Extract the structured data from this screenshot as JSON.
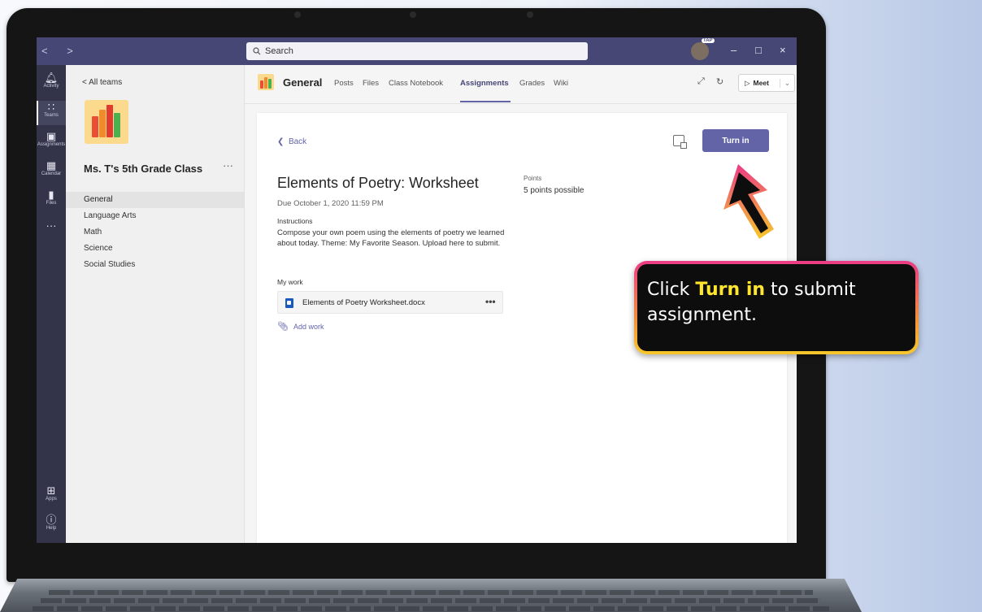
{
  "titlebar": {
    "nav_arrows": "< >",
    "search_placeholder": "Search",
    "avatar_badge": "TAP",
    "minimize": "–",
    "maximize": "□",
    "close": "×"
  },
  "rail": {
    "items": [
      {
        "icon": "bell-icon",
        "glyph": "🔔",
        "label": "Activity"
      },
      {
        "icon": "teams-icon",
        "glyph": "👥",
        "label": "Teams"
      },
      {
        "icon": "assignments-icon",
        "glyph": "🎒",
        "label": "Assignments"
      },
      {
        "icon": "calendar-icon",
        "glyph": "▦",
        "label": "Calendar"
      },
      {
        "icon": "files-icon",
        "glyph": "▮",
        "label": "Files"
      },
      {
        "icon": "more-icon",
        "glyph": "···",
        "label": ""
      },
      {
        "icon": "apps-icon",
        "glyph": "⊞",
        "label": "Apps"
      },
      {
        "icon": "help-icon",
        "glyph": "?",
        "label": "Help"
      }
    ]
  },
  "sidebar": {
    "all_teams": "< All teams",
    "class_name": "Ms. T's 5th Grade Class",
    "more": "···",
    "channels": [
      "General",
      "Language Arts",
      "Math",
      "Science",
      "Social Studies"
    ]
  },
  "header": {
    "channel": "General",
    "tabs": [
      "Posts",
      "Files",
      "Class Notebook",
      "Assignments",
      "Grades",
      "Wiki"
    ],
    "active_tab": "Assignments",
    "expand_icon": "⤢",
    "refresh_icon": "↻",
    "meet_label": "Meet",
    "meet_chevron": "⌄"
  },
  "assignment": {
    "back_label": "Back",
    "turn_in_label": "Turn in",
    "title": "Elements of Poetry: Worksheet",
    "due": "Due October 1, 2020 11:59 PM",
    "points_label": "Points",
    "points_value": "5 points possible",
    "instructions_label": "Instructions",
    "instructions_text": "Compose your own poem using the elements of poetry we learned about today. Theme: My Favorite Season. Upload here to submit.",
    "my_work_label": "My work",
    "file_name": "Elements of Poetry Worksheet.docx",
    "file_more": "•••",
    "add_work_label": "Add work"
  },
  "callout": {
    "prefix": "Click ",
    "highlight": "Turn in",
    "suffix": " to submit assignment."
  },
  "colors": {
    "titlebar": "#464775",
    "accent": "#6264a7",
    "rail": "#33344a",
    "callout_highlight": "#ffe52e"
  }
}
